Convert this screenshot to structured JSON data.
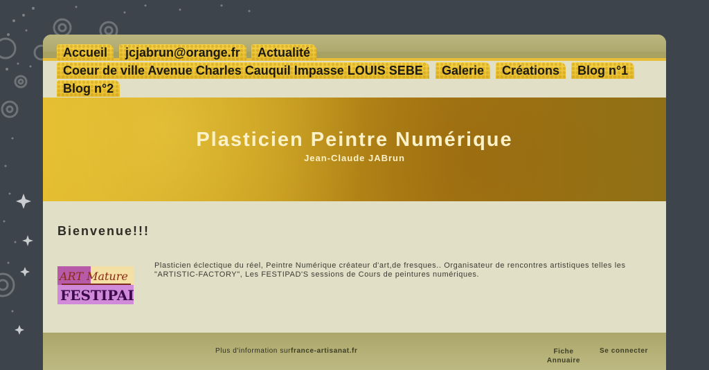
{
  "nav": {
    "items": [
      {
        "label": "Accueil"
      },
      {
        "label": "jcjabrun@orange.fr"
      },
      {
        "label": "Actualité"
      },
      {
        "label": "Coeur de ville Avenue Charles Cauquil Impasse LOUIS SEBE"
      },
      {
        "label": "Galerie"
      },
      {
        "label": "Créations"
      },
      {
        "label": "Blog n°1"
      },
      {
        "label": "Blog n°2"
      }
    ]
  },
  "banner": {
    "title": "Plasticien Peintre Numérique",
    "subtitle": "Jean-Claude JABrun"
  },
  "content": {
    "heading": "Bienvenue!!!",
    "logo_text_top": "ART Mature",
    "logo_text_bottom": "FESTIPAD",
    "intro": "Plasticien éclectique du réel, Peintre Numérique créateur d'art,de fresques.. Organisateur de rencontres artistiques telles les \"ARTISTIC-FACTORY\", Les FESTIPAD'S sessions de Cours de peintures numériques."
  },
  "footer": {
    "info_text": "Plus d'information sur",
    "info_link": "france-artisanat.fr",
    "fiche_line1": "Fiche",
    "fiche_line2": "Annuaire",
    "login": "Se connecter"
  },
  "colors": {
    "page_bg": "#3e444b",
    "card_bg": "#e1dfc6",
    "tab_gold": "#f0cd43",
    "banner_gold": "#c69a1c",
    "footer_olive": "#aba66a"
  }
}
